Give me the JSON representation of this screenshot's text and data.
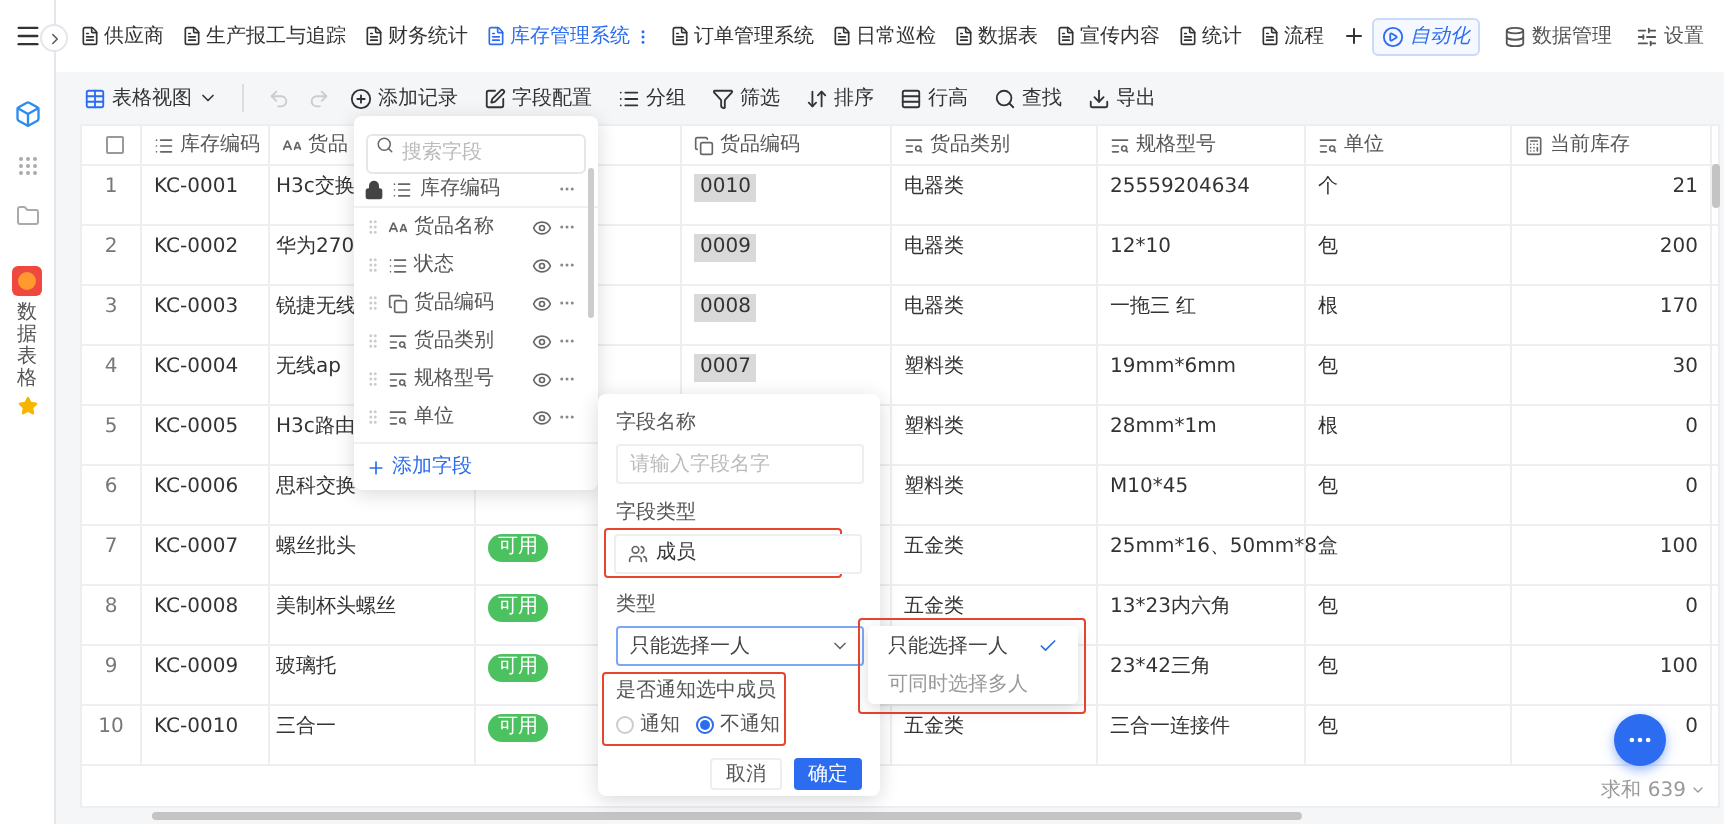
{
  "tabs": [
    {
      "label": "供应商",
      "selected": false
    },
    {
      "label": "生产报工与追踪",
      "selected": false
    },
    {
      "label": "财务统计",
      "selected": false
    },
    {
      "label": "库存管理系统",
      "selected": true
    },
    {
      "label": "订单管理系统",
      "selected": false
    },
    {
      "label": "日常巡检",
      "selected": false
    },
    {
      "label": "数据表",
      "selected": false
    },
    {
      "label": "宣传内容",
      "selected": false
    },
    {
      "label": "统计",
      "selected": false
    },
    {
      "label": "流程",
      "selected": false
    }
  ],
  "top_actions": [
    {
      "label": "自动化",
      "kind": "automation"
    },
    {
      "label": "数据管理",
      "kind": "data"
    },
    {
      "label": "设置",
      "kind": "settings"
    }
  ],
  "sidebar": {
    "app_label": "数据表格",
    "starred": true
  },
  "toolbar": {
    "view": "表格视图",
    "actions": [
      {
        "label": "添加记录",
        "kind": "add"
      },
      {
        "label": "字段配置",
        "kind": "fields"
      },
      {
        "label": "分组",
        "kind": "group"
      },
      {
        "label": "筛选",
        "kind": "filter"
      },
      {
        "label": "排序",
        "kind": "sort"
      },
      {
        "label": "行高",
        "kind": "height"
      },
      {
        "label": "查找",
        "kind": "search"
      },
      {
        "label": "导出",
        "kind": "export"
      }
    ]
  },
  "table": {
    "columns": [
      {
        "kind": "checkbox",
        "checked": false
      },
      {
        "label": "库存编码",
        "kind": "list"
      },
      {
        "label": "货品",
        "kind": "text"
      },
      {
        "kind": "status"
      },
      {
        "label": "货品编码",
        "kind": "link"
      },
      {
        "label": "货品类别",
        "kind": "select"
      },
      {
        "label": "规格型号",
        "kind": "select"
      },
      {
        "label": "单位",
        "kind": "select"
      },
      {
        "label": "当前库存",
        "kind": "number"
      }
    ],
    "rows": [
      {
        "index": "1",
        "code": "KC-0001",
        "name": "H3c交换",
        "item_code": "0010",
        "category": "电器类",
        "spec": "25559204634",
        "unit": "个",
        "stock": "21"
      },
      {
        "index": "2",
        "code": "KC-0002",
        "name": "华为270",
        "item_code": "0009",
        "category": "电器类",
        "spec": "12*10",
        "unit": "包",
        "stock": "200"
      },
      {
        "index": "3",
        "code": "KC-0003",
        "name": "锐捷无线",
        "item_code": "0008",
        "category": "电器类",
        "spec": "一拖三 红",
        "unit": "根",
        "stock": "170"
      },
      {
        "index": "4",
        "code": "KC-0004",
        "name": "无线ap",
        "item_code": "0007",
        "category": "塑料类",
        "spec": "19mm*6mm",
        "unit": "包",
        "stock": "30"
      },
      {
        "index": "5",
        "code": "KC-0005",
        "name": "H3c路由",
        "category": "塑料类",
        "spec": "28mm*1m",
        "unit": "根",
        "stock": "0"
      },
      {
        "index": "6",
        "code": "KC-0006",
        "name": "思科交换",
        "category": "塑料类",
        "spec": "M10*45",
        "unit": "包",
        "stock": "0"
      },
      {
        "index": "7",
        "code": "KC-0007",
        "name": "螺丝批头",
        "status": "可用",
        "category": "五金类",
        "spec": "25mm*16、50mm*8",
        "unit": "盒",
        "stock": "100"
      },
      {
        "index": "8",
        "code": "KC-0008",
        "name": "美制杯头螺丝",
        "status": "可用",
        "category": "五金类",
        "spec": "13*23内六角",
        "unit": "包",
        "stock": "0"
      },
      {
        "index": "9",
        "code": "KC-0009",
        "name": "玻璃托",
        "status": "可用",
        "spec": "23*42三角",
        "unit": "包",
        "stock": "100"
      },
      {
        "index": "10",
        "code": "KC-0010",
        "name": "三合一",
        "status": "可用",
        "category": "五金类",
        "spec": "三合一连接件",
        "unit": "包",
        "stock": "0"
      }
    ],
    "footer": {
      "sum": "求和 639"
    }
  },
  "field_panel": {
    "search_placeholder": "搜索字段",
    "locked_field": {
      "label": "库存编码",
      "kind": "list"
    },
    "fields": [
      {
        "label": "货品名称",
        "kind": "text",
        "visible": true
      },
      {
        "label": "状态",
        "kind": "list",
        "visible": true
      },
      {
        "label": "货品编码",
        "kind": "link",
        "visible": true
      },
      {
        "label": "货品类别",
        "kind": "select",
        "visible": true
      },
      {
        "label": "规格型号",
        "kind": "select",
        "visible": true
      },
      {
        "label": "单位",
        "kind": "select",
        "visible": true
      }
    ],
    "add_label": "添加字段"
  },
  "field_editor": {
    "name_label": "字段名称",
    "name_placeholder": "请输入字段名字",
    "type_label": "字段类型",
    "type_value": "成员",
    "mode_label": "类型",
    "mode_value": "只能选择一人",
    "notify_label": "是否通知选中成员",
    "notify_options": [
      {
        "label": "通知",
        "selected": false
      },
      {
        "label": "不通知",
        "selected": true
      }
    ],
    "buttons": [
      {
        "label": "取消",
        "kind": "secondary"
      },
      {
        "label": "确定",
        "kind": "primary"
      }
    ]
  },
  "mode_dropdown": {
    "options": [
      {
        "label": "只能选择一人",
        "selected": true
      },
      {
        "label": "可同时选择多人",
        "selected": false
      }
    ]
  }
}
